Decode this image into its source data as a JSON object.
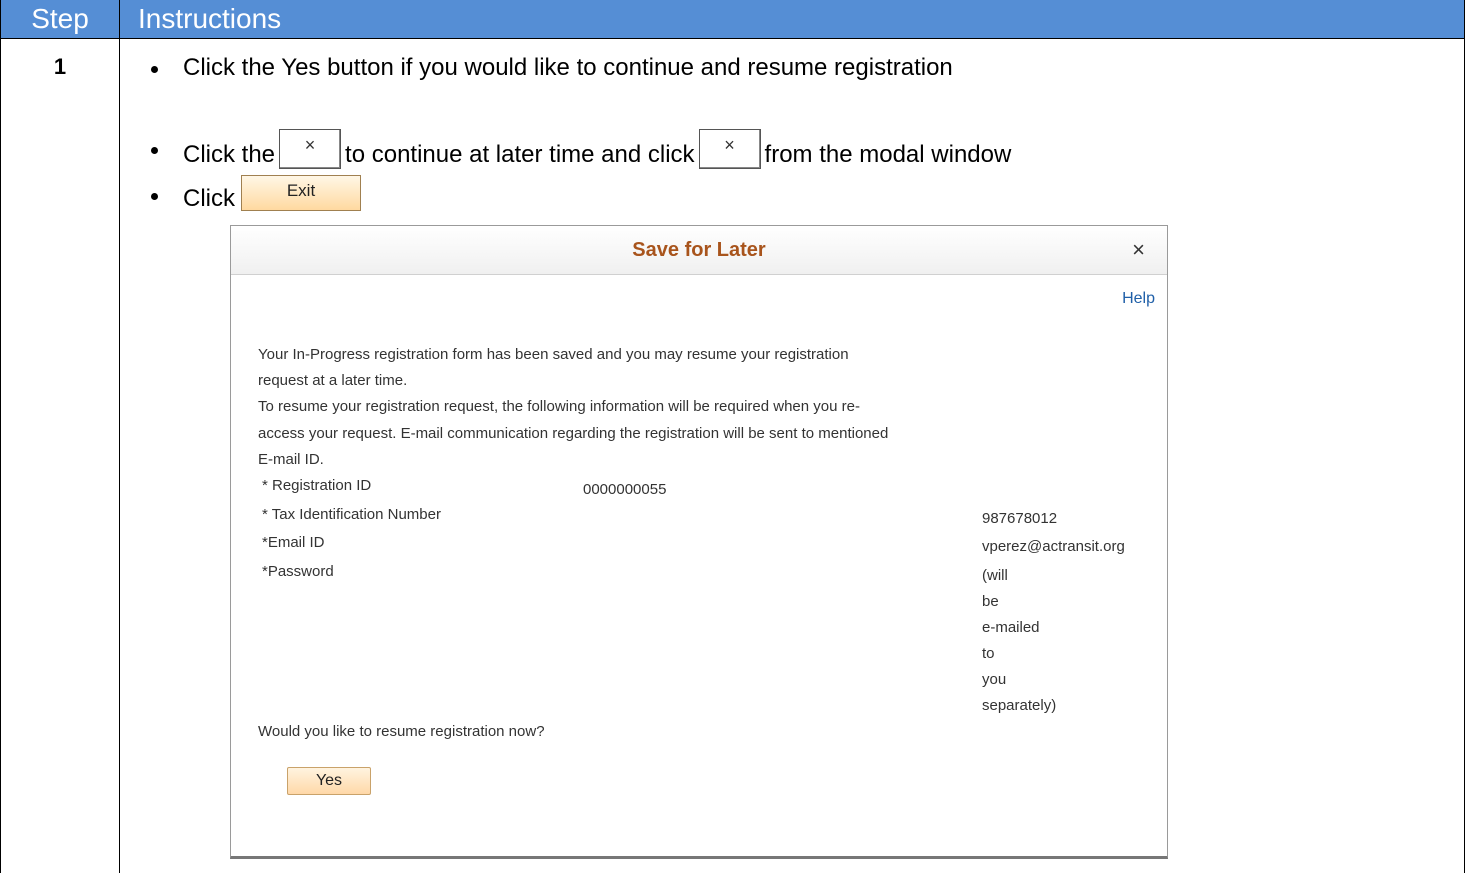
{
  "header": {
    "step": "Step",
    "instructions": "Instructions"
  },
  "step_number": "1",
  "bullets": [
    {
      "parts": [
        "Click the Yes button if you would like to continue and resume registration"
      ]
    },
    {
      "before": "Click the",
      "middle": "to continue at later time and click",
      "after": "from the modal window"
    },
    {
      "before": "Click",
      "exit_label": "Exit"
    }
  ],
  "inline_close_glyph": "×",
  "modal": {
    "title": "Save for Later",
    "close_glyph": "×",
    "help": "Help",
    "paragraph_lines": [
      "Your In-Progress registration form has been saved and you may resume your registration",
      "request at a later time.",
      "To resume your registration request, the following information will be required when you re-",
      "access your request. E-mail communication regarding the registration will be sent to mentioned",
      "E-mail ID."
    ],
    "fields": [
      {
        "label": "* Registration ID",
        "value": "0000000055"
      },
      {
        "label": "* Tax Identification Number",
        "value": "987678012"
      },
      {
        "label": "*Email ID",
        "value": "vperez@actransit.org"
      },
      {
        "label": "*Password",
        "value_lines": [
          "(will",
          "be",
          "e-mailed",
          "to",
          "you",
          "separately)"
        ]
      }
    ],
    "question": "Would you like to resume registration now?",
    "yes_label": "Yes"
  }
}
